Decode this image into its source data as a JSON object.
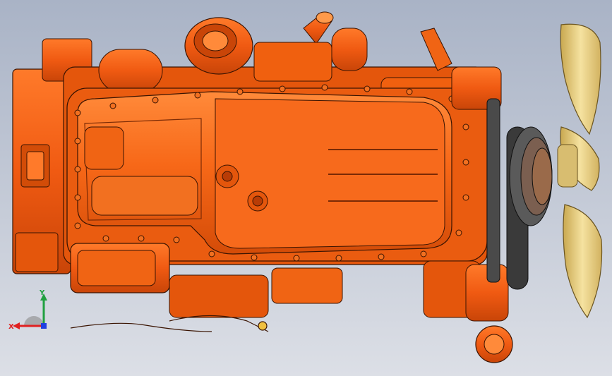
{
  "viewport": {
    "background_top": "#a9b3c6",
    "background_bottom": "#dcdfe6"
  },
  "model": {
    "body_color": "#f05a12",
    "shadow_color": "#b83c06",
    "edge_color": "#3a1402",
    "fan_color": "#f0d98a",
    "belt_color": "#3a3a3a"
  },
  "triad": {
    "x_label": "X",
    "y_label": "Y",
    "x_color": "#e02020",
    "y_color": "#20a040",
    "z_color": "#2040e0"
  }
}
